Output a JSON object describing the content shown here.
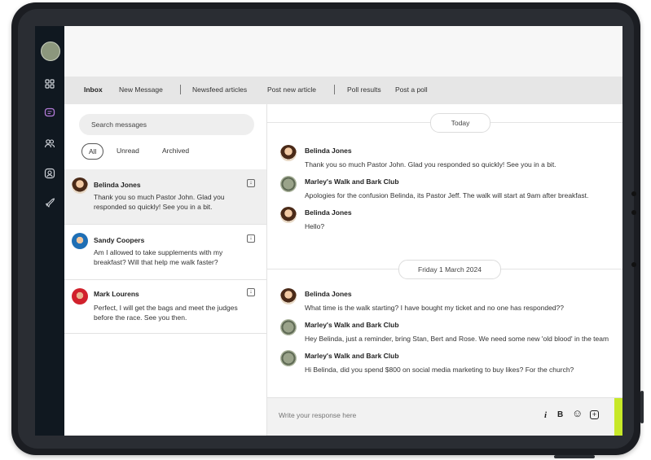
{
  "nav": {
    "items": [
      {
        "label": "Inbox",
        "active": true
      },
      {
        "label": "New Message"
      },
      {
        "label": "Newsfeed articles"
      },
      {
        "label": "Post new article"
      },
      {
        "label": "Poll results"
      },
      {
        "label": "Post a poll"
      }
    ]
  },
  "sidebar": {
    "icons": [
      "grid-icon",
      "chat-icon",
      "people-icon",
      "user-circle-icon",
      "rocket-icon"
    ]
  },
  "inbox": {
    "search_placeholder": "Search messages",
    "filters": [
      "All",
      "Unread",
      "Archived"
    ],
    "threads": [
      {
        "name": "Belinda Jones",
        "preview": "Thank you so much Pastor John. Glad you responded so quickly! See you in a bit.",
        "selected": true
      },
      {
        "name": "Sandy Coopers",
        "preview": "Am I allowed to take supplements with my breakfast? Will that help me walk faster?"
      },
      {
        "name": "Mark Lourens",
        "preview": "Perfect, I will get the bags and meet the judges before the race. See you then."
      }
    ]
  },
  "conversation": {
    "groups": [
      {
        "date": "Today",
        "messages": [
          {
            "sender": "Belinda Jones",
            "text": "Thank you so much Pastor John. Glad you responded so quickly! See you in a bit."
          },
          {
            "sender": "Marley's Walk and Bark Club",
            "text": "Apologies for the confusion Belinda, its Pastor Jeff. The walk will start at 9am after breakfast."
          },
          {
            "sender": "Belinda Jones",
            "text": "Hello?"
          }
        ]
      },
      {
        "date": "Friday 1 March 2024",
        "messages": [
          {
            "sender": "Belinda Jones",
            "text": "What time is the walk starting? I have bought my ticket and no one has responded??"
          },
          {
            "sender": "Marley's Walk and Bark Club",
            "text": "Hey Belinda, just a reminder, bring Stan, Bert and Rose. We need some new 'old blood' in the team"
          },
          {
            "sender": "Marley's Walk and Bark Club",
            "text": "Hi Belinda, did you spend $800 on social media marketing to buy likes? For the church?"
          }
        ]
      }
    ]
  },
  "composer": {
    "placeholder": "Write your response here",
    "italic": "i",
    "bold": "B",
    "emoji": "☺"
  },
  "colors": {
    "rail": "#101820",
    "send": "#c7e829"
  }
}
